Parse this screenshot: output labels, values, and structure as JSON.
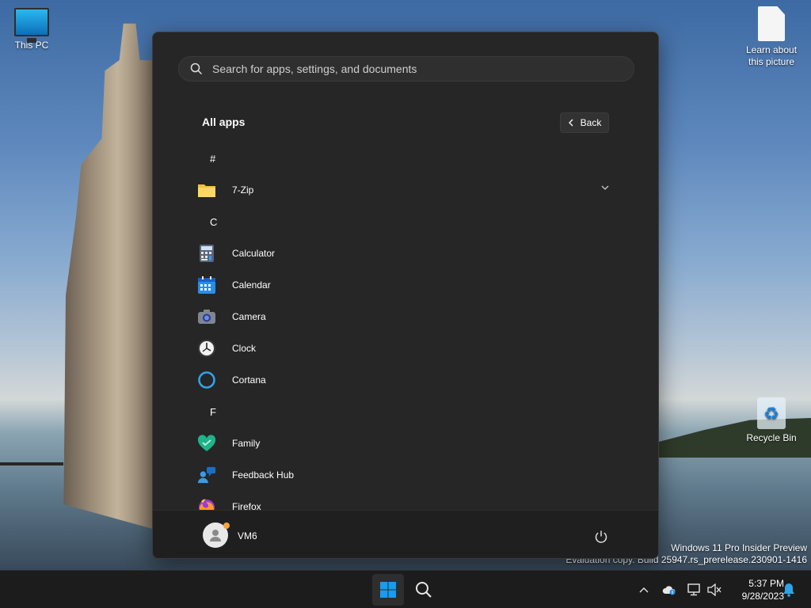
{
  "desktop": {
    "icons": [
      {
        "label": "This PC"
      },
      {
        "label_line1": "Learn about",
        "label_line2": "this picture"
      },
      {
        "label": "Recycle Bin"
      }
    ],
    "watermark": {
      "line1": "Windows 11 Pro Insider Preview",
      "line2": "Evaluation copy. Build 25947.rs_prerelease.230901-1416"
    }
  },
  "start_menu": {
    "search": {
      "placeholder": "Search for apps, settings, and documents"
    },
    "title": "All apps",
    "back_label": "Back",
    "list": [
      {
        "kind": "letter",
        "text": "#"
      },
      {
        "kind": "app",
        "text": "7-Zip",
        "icon": "folder-icon",
        "expandable": true
      },
      {
        "kind": "letter",
        "text": "C"
      },
      {
        "kind": "app",
        "text": "Calculator",
        "icon": "calculator-icon"
      },
      {
        "kind": "app",
        "text": "Calendar",
        "icon": "calendar-icon"
      },
      {
        "kind": "app",
        "text": "Camera",
        "icon": "camera-icon"
      },
      {
        "kind": "app",
        "text": "Clock",
        "icon": "clock-icon"
      },
      {
        "kind": "app",
        "text": "Cortana",
        "icon": "cortana-icon"
      },
      {
        "kind": "letter",
        "text": "F"
      },
      {
        "kind": "app",
        "text": "Family",
        "icon": "family-heart-icon"
      },
      {
        "kind": "app",
        "text": "Feedback Hub",
        "icon": "feedback-hub-icon"
      },
      {
        "kind": "app",
        "text": "Firefox",
        "icon": "firefox-icon"
      }
    ],
    "user": {
      "name": "VM6"
    }
  },
  "taskbar": {
    "time": "5:37 PM",
    "date": "9/28/2023"
  },
  "colors": {
    "menu_bg": "#262626",
    "footer_bg": "#1f1f1f",
    "taskbar_bg": "#1c1c1c",
    "accent": "#0078d4"
  }
}
